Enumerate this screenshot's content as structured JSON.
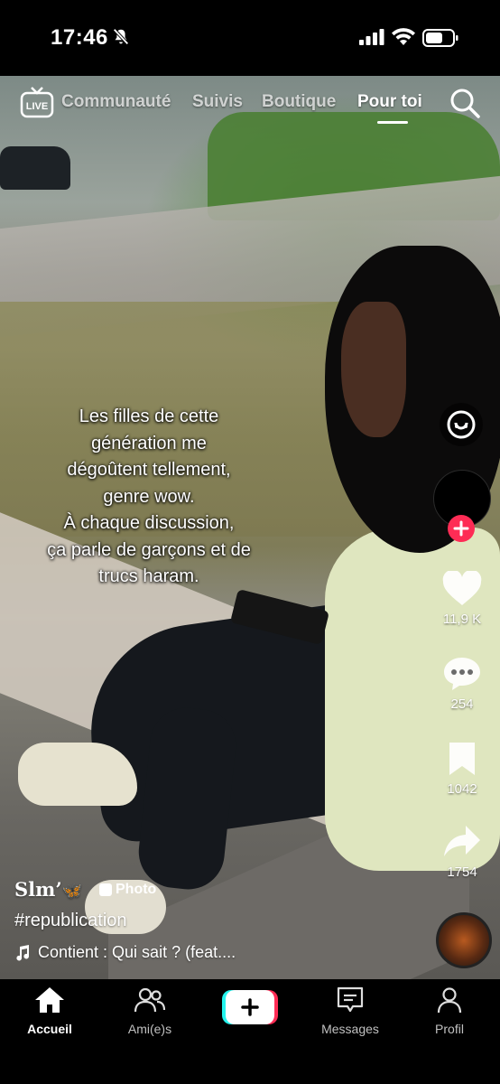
{
  "status_bar": {
    "time": "17:46"
  },
  "top_tabs": {
    "tabs": [
      {
        "label": "Communauté"
      },
      {
        "label": "Suivis"
      },
      {
        "label": "Boutique"
      },
      {
        "label": "Pour toi"
      }
    ],
    "active_tab": "Pour toi",
    "live_label": "LIVE"
  },
  "caption": {
    "lines": [
      "Les filles de cette",
      "génération me",
      "dégoûtent tellement,",
      "genre wow.",
      "À chaque discussion,",
      "ça parle de garçons et de",
      "trucs haram."
    ]
  },
  "actions": {
    "likes": "11,9 K",
    "comments": "254",
    "saves": "1042",
    "shares": "1754"
  },
  "post": {
    "author": "Slm’",
    "author_emoji": "🦋",
    "badge": "Photo",
    "hashtag": "#republication",
    "sound": "Contient : Qui sait ? (feat...."
  },
  "bottom_nav": {
    "items": [
      {
        "label": "Accueil"
      },
      {
        "label": "Ami(e)s"
      },
      {
        "label": "Messages"
      },
      {
        "label": "Profil"
      }
    ],
    "active": "Accueil"
  },
  "colors": {
    "accent": "#fe2c55",
    "create_left": "#25f4ee",
    "create_right": "#fe2c55"
  },
  "icons": [
    "bell-slash-icon",
    "signal-icon",
    "wifi-icon",
    "battery-icon",
    "live-icon",
    "search-icon",
    "compass-icon",
    "plus-icon",
    "heart-icon",
    "comment-icon",
    "bookmark-icon",
    "share-icon",
    "music-note-icon",
    "home-icon",
    "friends-icon",
    "inbox-icon",
    "profile-icon"
  ]
}
